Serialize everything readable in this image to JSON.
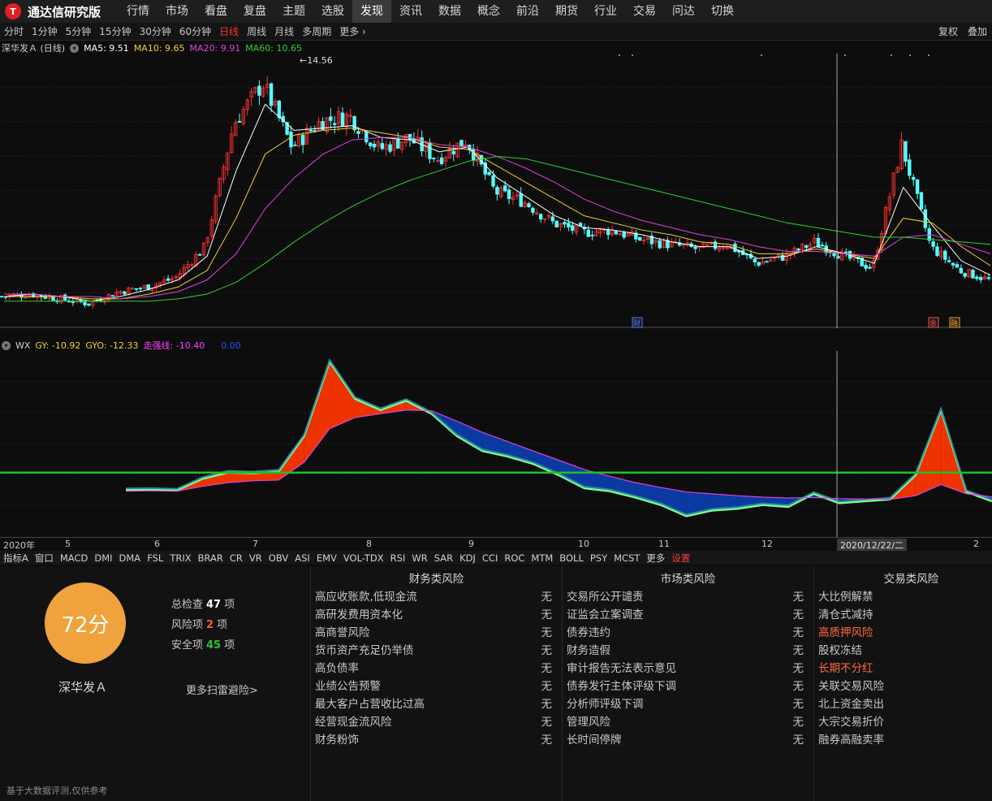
{
  "app": {
    "logo_letter": "T",
    "title": "通达信研究版",
    "menu": [
      "行情",
      "市场",
      "看盘",
      "复盘",
      "主题",
      "选股",
      "发现",
      "资讯",
      "数据",
      "概念",
      "前沿",
      "期货",
      "行业",
      "交易",
      "问达",
      "切换"
    ],
    "active_menu": "发现"
  },
  "periods": {
    "items": [
      "分时",
      "1分钟",
      "5分钟",
      "15分钟",
      "30分钟",
      "60分钟",
      "日线",
      "周线",
      "月线",
      "多周期",
      "更多 ›"
    ],
    "active": "日线",
    "right": [
      "复权",
      "叠加"
    ]
  },
  "main_legend": {
    "stock": "深华发Ａ (日线)",
    "ma5": "MA5: 9.51",
    "ma10": "MA10: 9.65",
    "ma20": "MA20: 9.91",
    "ma60": "MA60: 10.65",
    "colors": {
      "ma5": "#ffffff",
      "ma10": "#f0d030",
      "ma20": "#e040e0",
      "ma60": "#30d030"
    }
  },
  "sub_legend": {
    "name": "WX",
    "gy": "GY: -10.92",
    "gyo": "GYO: -12.33",
    "zq": "走强线: -10.40",
    "zero": "0.00"
  },
  "chart_data": {
    "type": "line",
    "title": "深华发Ａ (日线)",
    "peak_label": "14.56",
    "x": [
      "2020-04",
      "2020-05",
      "2020-06",
      "2020-07",
      "2020-08",
      "2020-09",
      "2020-10",
      "2020-11",
      "2020-12",
      "2021-01",
      "2021-02"
    ],
    "close_series": [
      5.2,
      5.3,
      5.1,
      4.9,
      5.4,
      5.6,
      6.0,
      7.3,
      12.5,
      14.2,
      11.5,
      12.6,
      12.8,
      11.4,
      11.9,
      11.0,
      11.8,
      9.6,
      9.2,
      8.3,
      7.9,
      8.0,
      7.6,
      7.4,
      7.2,
      7.4,
      6.6,
      6.9,
      7.5,
      6.9,
      6.4,
      11.6,
      7.3,
      6.3,
      5.9
    ],
    "series": [
      {
        "name": "MA5",
        "values": [
          5.2,
          5.3,
          5.2,
          5.0,
          5.2,
          5.5,
          5.9,
          6.9,
          10.5,
          13.3,
          12.2,
          12.3,
          12.4,
          11.9,
          11.8,
          11.3,
          11.5,
          10.2,
          9.4,
          8.6,
          8.1,
          8.0,
          7.8,
          7.5,
          7.3,
          7.3,
          6.8,
          6.9,
          7.3,
          7.0,
          6.6,
          9.8,
          8.2,
          6.7,
          6.1
        ]
      },
      {
        "name": "MA10",
        "values": [
          5.2,
          5.2,
          5.2,
          5.1,
          5.1,
          5.3,
          5.6,
          6.3,
          8.5,
          11.2,
          12.0,
          12.2,
          12.3,
          12.1,
          11.9,
          11.5,
          11.4,
          10.7,
          10.0,
          9.3,
          8.6,
          8.3,
          8.0,
          7.8,
          7.5,
          7.4,
          7.0,
          7.0,
          7.2,
          7.0,
          6.8,
          8.5,
          8.3,
          7.3,
          6.5
        ]
      },
      {
        "name": "MA20",
        "values": [
          5.3,
          5.3,
          5.2,
          5.2,
          5.1,
          5.2,
          5.4,
          5.9,
          7.0,
          8.9,
          10.2,
          11.2,
          11.8,
          11.9,
          11.9,
          11.6,
          11.5,
          11.1,
          10.6,
          10.0,
          9.3,
          8.8,
          8.4,
          8.1,
          7.8,
          7.6,
          7.3,
          7.1,
          7.1,
          7.0,
          6.9,
          7.7,
          7.8,
          7.4,
          7.0
        ]
      },
      {
        "name": "MA60",
        "values": [
          5.0,
          5.0,
          5.0,
          5.0,
          5.0,
          5.0,
          5.1,
          5.3,
          5.8,
          6.6,
          7.5,
          8.3,
          9.0,
          9.6,
          10.1,
          10.5,
          10.9,
          11.1,
          11.0,
          10.7,
          10.4,
          10.1,
          9.8,
          9.5,
          9.2,
          8.9,
          8.6,
          8.3,
          8.1,
          7.9,
          7.7,
          7.7,
          7.6,
          7.5,
          7.4
        ]
      }
    ],
    "sub_series": [
      {
        "name": "GY",
        "values": [
          -10.5,
          -10.4,
          -10.6,
          -7.5,
          -5.8,
          -6.0,
          -5.5,
          4.0,
          24.0,
          14.0,
          11.0,
          13.5,
          10.0,
          4.0,
          0.0,
          -1.5,
          -3.5,
          -6.5,
          -10.0,
          -10.8,
          -12.5,
          -14.5,
          -17.5,
          -16.0,
          -15.5,
          -14.5,
          -15.0,
          -11.5,
          -14.0,
          -13.5,
          -13.0,
          -6.5,
          11.0,
          -11.0,
          -13.5
        ]
      },
      {
        "name": "GYO",
        "values": [
          -10.8,
          -10.7,
          -10.8,
          -9.5,
          -8.5,
          -8.0,
          -7.8,
          -3.0,
          6.0,
          9.0,
          10.0,
          11.0,
          10.8,
          8.0,
          5.0,
          2.5,
          0.0,
          -2.5,
          -5.0,
          -6.8,
          -8.5,
          -9.8,
          -11.0,
          -11.5,
          -12.0,
          -12.4,
          -12.6,
          -12.5,
          -12.8,
          -12.9,
          -13.0,
          -12.0,
          -9.0,
          -11.5,
          -12.3
        ]
      }
    ],
    "sub_zero_level": -5.8,
    "colors": {
      "up": "#ff3232",
      "down": "#54ffff",
      "pos_fill": "#ee3300",
      "neg_fill": "#0a3aa0",
      "zq": "#e040e0",
      "zero": "#20c020"
    }
  },
  "date_axis": {
    "labels": [
      "2020年",
      "5",
      "6",
      "7",
      "8",
      "9",
      "10",
      "11",
      "12",
      "1",
      "2"
    ],
    "cursor_date": "2020/12/22/二",
    "markers": [
      "财",
      "余",
      "融"
    ]
  },
  "indicators": {
    "items": [
      "指标A",
      "窗口",
      "MACD",
      "DMI",
      "DMA",
      "FSL",
      "TRIX",
      "BRAR",
      "CR",
      "VR",
      "OBV",
      "ASI",
      "EMV",
      "VOL-TDX",
      "RSI",
      "WR",
      "SAR",
      "KDJ",
      "CCI",
      "ROC",
      "MTM",
      "BOLL",
      "PSY",
      "MCST",
      "更多",
      "设置"
    ],
    "red": [
      "设置"
    ]
  },
  "risk": {
    "score": "72分",
    "stock_name": "深华发Ａ",
    "stats": [
      {
        "label": "总检查",
        "value": "47",
        "unit": "项",
        "color": "#ffffff"
      },
      {
        "label": "风险项",
        "value": "2",
        "unit": "项",
        "color": "#ff5a2a"
      },
      {
        "label": "安全项",
        "value": "45",
        "unit": "项",
        "color": "#30c030"
      }
    ],
    "more": "更多扫雷避险>",
    "footnote": "基于大数据评测,仅供参考",
    "columns": [
      {
        "title": "财务类风险",
        "rows": [
          {
            "label": "高应收账款,低现金流",
            "val": "无"
          },
          {
            "label": "高研发费用资本化",
            "val": "无"
          },
          {
            "label": "高商誉风险",
            "val": "无"
          },
          {
            "label": "货币资产充足仍举债",
            "val": "无"
          },
          {
            "label": "高负债率",
            "val": "无"
          },
          {
            "label": "业绩公告预警",
            "val": "无"
          },
          {
            "label": "最大客户占营收比过高",
            "val": "无"
          },
          {
            "label": "经营现金流风险",
            "val": "无"
          },
          {
            "label": "财务粉饰",
            "val": "无"
          }
        ]
      },
      {
        "title": "市场类风险",
        "rows": [
          {
            "label": "交易所公开谴责",
            "val": "无"
          },
          {
            "label": "证监会立案调查",
            "val": "无"
          },
          {
            "label": "债券违约",
            "val": "无"
          },
          {
            "label": "财务造假",
            "val": "无"
          },
          {
            "label": "审计报告无法表示意见",
            "val": "无"
          },
          {
            "label": "债券发行主体评级下调",
            "val": "无"
          },
          {
            "label": "分析师评级下调",
            "val": "无"
          },
          {
            "label": "管理风险",
            "val": "无"
          },
          {
            "label": "长时间停牌",
            "val": "无"
          }
        ]
      },
      {
        "title": "交易类风险",
        "rows": [
          {
            "label": "大比例解禁",
            "val": "无",
            "warn": false
          },
          {
            "label": "清仓式减持",
            "val": "无",
            "warn": false
          },
          {
            "label": "高质押风险",
            "val": "✕",
            "warn": true
          },
          {
            "label": "股权冻结",
            "val": "无",
            "warn": false
          },
          {
            "label": "长期不分红",
            "val": "✕",
            "warn": true
          },
          {
            "label": "关联交易风险",
            "val": "无",
            "warn": false
          },
          {
            "label": "北上资金卖出",
            "val": "无",
            "warn": false
          },
          {
            "label": "大宗交易折价",
            "val": "无",
            "warn": false
          },
          {
            "label": "融券高融卖率",
            "val": "无",
            "warn": false
          }
        ]
      }
    ]
  }
}
